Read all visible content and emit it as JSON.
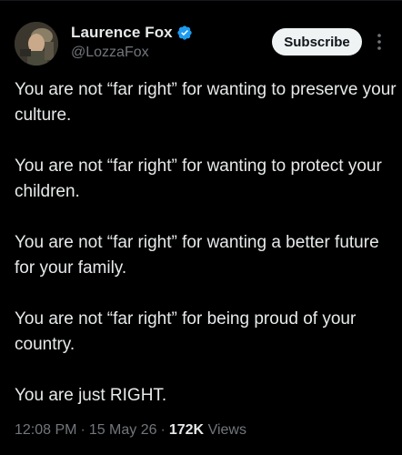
{
  "author": {
    "display_name": "Laurence Fox",
    "handle": "@LozzaFox",
    "verified_color": "#1d9bf0"
  },
  "actions": {
    "subscribe_label": "Subscribe",
    "more_icon": "vertical-ellipsis"
  },
  "tweet": {
    "paragraphs": [
      "You are not “far right” for wanting to preserve your culture.",
      "You are not “far right” for wanting to protect your children.",
      "You are not “far right” for wanting a better future for your family.",
      "You are not “far right” for being proud of your country.",
      "You are just RIGHT."
    ]
  },
  "meta": {
    "time": "12:08 PM",
    "separator": "·",
    "date": "15 May 26",
    "views_count": "172K",
    "views_label": "Views"
  }
}
